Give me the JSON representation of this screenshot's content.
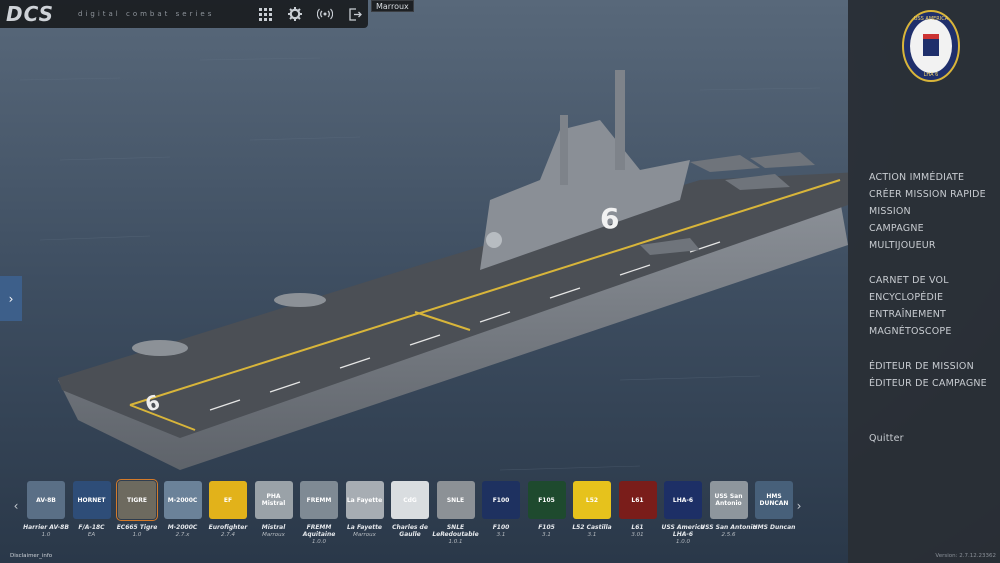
{
  "topbar": {
    "logo": "DCS",
    "subtitle": "digital combat series",
    "icons": [
      "apps-grid-icon",
      "gear-icon",
      "broadcast-icon",
      "logout-icon"
    ]
  },
  "tooltip": "Marroux",
  "left_tab": {
    "icon": "chevron-right-icon"
  },
  "right_panel": {
    "emblem_text": [
      "USS AMERICA",
      "LHA 6"
    ],
    "menu": [
      "ACTION IMMÉDIATE",
      "CRÉER MISSION RAPIDE",
      "MISSION",
      "CAMPAGNE",
      "MULTIJOUEUR",
      "CARNET DE VOL",
      "ENCYCLOPÉDIE",
      "ENTRAÎNEMENT",
      "MAGNÉTOSCOPE",
      "ÉDITEUR DE MISSION",
      "ÉDITEUR DE CAMPAGNE",
      "Quitter"
    ],
    "version": "Version: 2.7.12.23362"
  },
  "scene": {
    "hull_number": "6"
  },
  "bottom": {
    "disclaimer": "Disclaimer_info",
    "modules": [
      {
        "name": "Harrier AV-8B",
        "version": "1.0",
        "thumb": "AV-8B",
        "color": "#5a6f86"
      },
      {
        "name": "F/A-18C",
        "version": "EA",
        "thumb": "HORNET",
        "color": "#2e4d78"
      },
      {
        "name": "EC665 Tigre",
        "version": "1.0",
        "thumb": "TIGRE",
        "color": "#6d6a5f",
        "selected": true
      },
      {
        "name": "M-2000C",
        "version": "2.7.x",
        "thumb": "M-2000C",
        "color": "#6b8299"
      },
      {
        "name": "Eurofighter",
        "version": "2.7.4",
        "thumb": "EF",
        "color": "#e2b21a"
      },
      {
        "name": "Mistral",
        "version": "Marroux",
        "thumb": "PHA Mistral",
        "color": "#9aa2a8"
      },
      {
        "name": "FREMM Aquitaine",
        "version": "1.0.0",
        "thumb": "FREMM",
        "color": "#7f8a94"
      },
      {
        "name": "La Fayette",
        "version": "Marroux",
        "thumb": "La Fayette",
        "color": "#a7adb3"
      },
      {
        "name": "Charles de Gaulle",
        "version": "",
        "thumb": "CdG",
        "color": "#d9dde0"
      },
      {
        "name": "SNLE LeRedoutable",
        "version": "1.0.1",
        "thumb": "SNLE",
        "color": "#8c9196"
      },
      {
        "name": "F100",
        "version": "3.1",
        "thumb": "F100",
        "color": "#1e3160"
      },
      {
        "name": "F105",
        "version": "3.1",
        "thumb": "F105",
        "color": "#1e4a2e"
      },
      {
        "name": "L52 Castilla",
        "version": "3.1",
        "thumb": "L52",
        "color": "#e6c21c"
      },
      {
        "name": "L61",
        "version": "3.01",
        "thumb": "L61",
        "color": "#7a1d1a"
      },
      {
        "name": "USS America LHA-6",
        "version": "1.0.0",
        "thumb": "LHA-6",
        "color": "#1d2f66"
      },
      {
        "name": "USS San Antonio",
        "version": "2.5.6",
        "thumb": "USS San Antonio",
        "color": "#8e969d"
      },
      {
        "name": "HMS Duncan",
        "version": "",
        "thumb": "HMS DUNCAN",
        "color": "#47607a"
      }
    ]
  }
}
